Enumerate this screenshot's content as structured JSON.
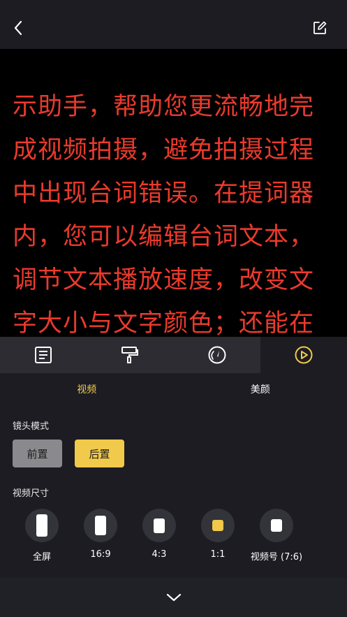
{
  "prompter": {
    "text": "示助手，帮助您更流畅地完成视频拍摄，避免拍摄过程中出现台词错误。在提词器内，您可以编辑台词文本，调节文本播放速度，改变文字大小与文字颜色；还能在",
    "text_color": "#ea3a2c"
  },
  "toolbar": {
    "icons": [
      "document-icon",
      "paint-roller-icon",
      "speedometer-icon",
      "play-circle-icon"
    ],
    "active_index": 3
  },
  "subtabs": {
    "video": "视频",
    "beauty": "美颜",
    "active": "video"
  },
  "lens_mode": {
    "label": "镜头模式",
    "front": "前置",
    "rear": "后置",
    "selected": "rear"
  },
  "video_size": {
    "label": "视频尺寸",
    "options": [
      "全屏",
      "16:9",
      "4:3",
      "1:1",
      "视频号 (7:6)"
    ],
    "selected": "1:1"
  },
  "colors": {
    "accent": "#f1c94b",
    "background": "#1c1c22",
    "toolbar": "#2c2c32"
  }
}
